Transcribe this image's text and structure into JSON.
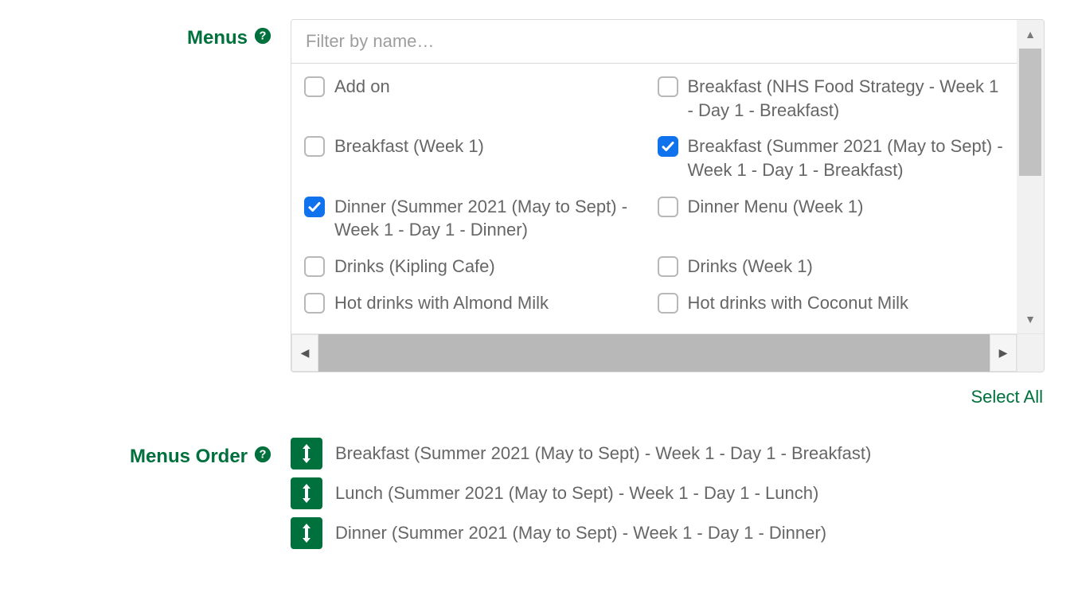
{
  "labels": {
    "menus": "Menus",
    "menus_order": "Menus Order"
  },
  "filter": {
    "placeholder": "Filter by name…"
  },
  "select_all": "Select All",
  "menus_list": [
    {
      "label": "Add on",
      "checked": false
    },
    {
      "label": "Breakfast (NHS Food Strategy - Week 1 - Day 1 - Breakfast)",
      "checked": false
    },
    {
      "label": "Breakfast (Week 1)",
      "checked": false
    },
    {
      "label": "Breakfast (Summer 2021 (May to Sept) - Week 1 - Day 1 - Breakfast)",
      "checked": true
    },
    {
      "label": "Dinner (Summer 2021 (May to Sept) - Week 1 - Day 1 - Dinner)",
      "checked": true
    },
    {
      "label": "Dinner Menu (Week 1)",
      "checked": false
    },
    {
      "label": "Drinks (Kipling Cafe)",
      "checked": false
    },
    {
      "label": "Drinks (Week 1)",
      "checked": false
    },
    {
      "label": "Hot drinks with Almond Milk",
      "checked": false
    },
    {
      "label": "Hot drinks with Coconut Milk",
      "checked": false
    }
  ],
  "menus_order": [
    "Breakfast (Summer 2021 (May to Sept) - Week 1 - Day 1 - Breakfast)",
    "Lunch (Summer 2021 (May to Sept) - Week 1 - Day 1 - Lunch)",
    "Dinner (Summer 2021 (May to Sept) - Week 1 - Day 1 - Dinner)"
  ]
}
